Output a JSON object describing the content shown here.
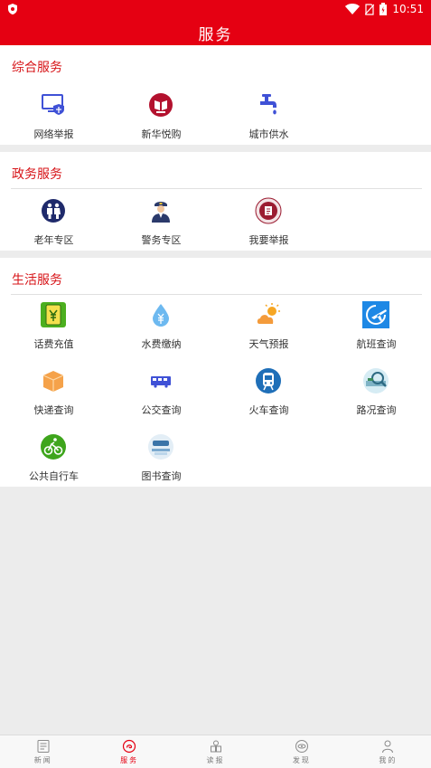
{
  "status": {
    "time": "10:51"
  },
  "header": {
    "title": "服务"
  },
  "sections": [
    {
      "title": "综合服务",
      "items": [
        {
          "label": "网络举报",
          "icon": "monitor-shield-icon"
        },
        {
          "label": "新华悦购",
          "icon": "book-badge-icon"
        },
        {
          "label": "城市供水",
          "icon": "faucet-icon"
        }
      ]
    },
    {
      "title": "政务服务",
      "items": [
        {
          "label": "老年专区",
          "icon": "elderly-icon"
        },
        {
          "label": "警务专区",
          "icon": "police-icon"
        },
        {
          "label": "我要举报",
          "icon": "report-seal-icon"
        }
      ]
    },
    {
      "title": "生活服务",
      "items": [
        {
          "label": "话费充值",
          "icon": "phone-recharge-icon"
        },
        {
          "label": "水费缴纳",
          "icon": "water-drop-icon"
        },
        {
          "label": "天气预报",
          "icon": "weather-icon"
        },
        {
          "label": "航班查询",
          "icon": "plane-icon"
        },
        {
          "label": "快递查询",
          "icon": "parcel-icon"
        },
        {
          "label": "公交查询",
          "icon": "bus-icon"
        },
        {
          "label": "火车查询",
          "icon": "train-icon"
        },
        {
          "label": "路况查询",
          "icon": "traffic-search-icon"
        },
        {
          "label": "公共自行车",
          "icon": "bicycle-icon"
        },
        {
          "label": "图书查询",
          "icon": "library-icon"
        }
      ]
    }
  ],
  "tabs": [
    {
      "label": "新闻",
      "icon": "news-icon",
      "active": false
    },
    {
      "label": "服务",
      "icon": "service-icon",
      "active": true
    },
    {
      "label": "读报",
      "icon": "newspaper-icon",
      "active": false
    },
    {
      "label": "发现",
      "icon": "discover-icon",
      "active": false
    },
    {
      "label": "我的",
      "icon": "profile-icon",
      "active": false
    }
  ],
  "colors": {
    "brand": "#e50012",
    "section_title": "#d71418"
  }
}
